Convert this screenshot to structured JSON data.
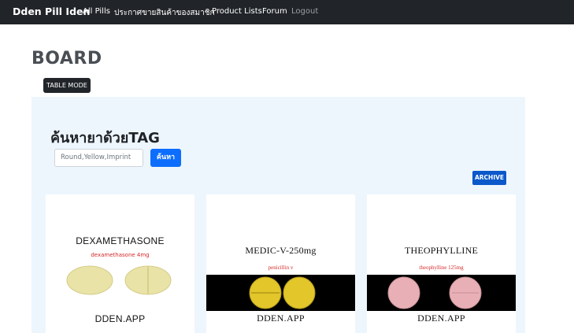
{
  "nav": {
    "brand": "Dden Pill Iden",
    "links": [
      "All Pills",
      "ประกาศขายสินค้าของสมาชิก",
      "Product Lists",
      "Forum"
    ],
    "logout": "Logout"
  },
  "board": {
    "title": "BOARD",
    "table_mode_label": "TABLE MODE"
  },
  "search": {
    "title": "ค้นหายาด้วยTAG",
    "placeholder": "Round,Yellow,Imprint",
    "button_label": "ค้นหา",
    "archive_label": "ARCHIVE"
  },
  "cards": [
    {
      "name": "DEXAMETHASONE",
      "subtitle": "dexamethasone 4mg",
      "footer": "DDEN.APP",
      "pill_color": "#e8e2a6",
      "background": "white"
    },
    {
      "name": "MEDIC-V-250mg",
      "subtitle": "penicillin v",
      "footer": "DDEN.APP",
      "pill_color": "#e2c62a",
      "background": "black"
    },
    {
      "name": "THEOPHYLLINE",
      "subtitle": "theophylline 125mg",
      "footer": "DDEN.APP",
      "pill_color": "#e8b0b6",
      "background": "black"
    }
  ]
}
